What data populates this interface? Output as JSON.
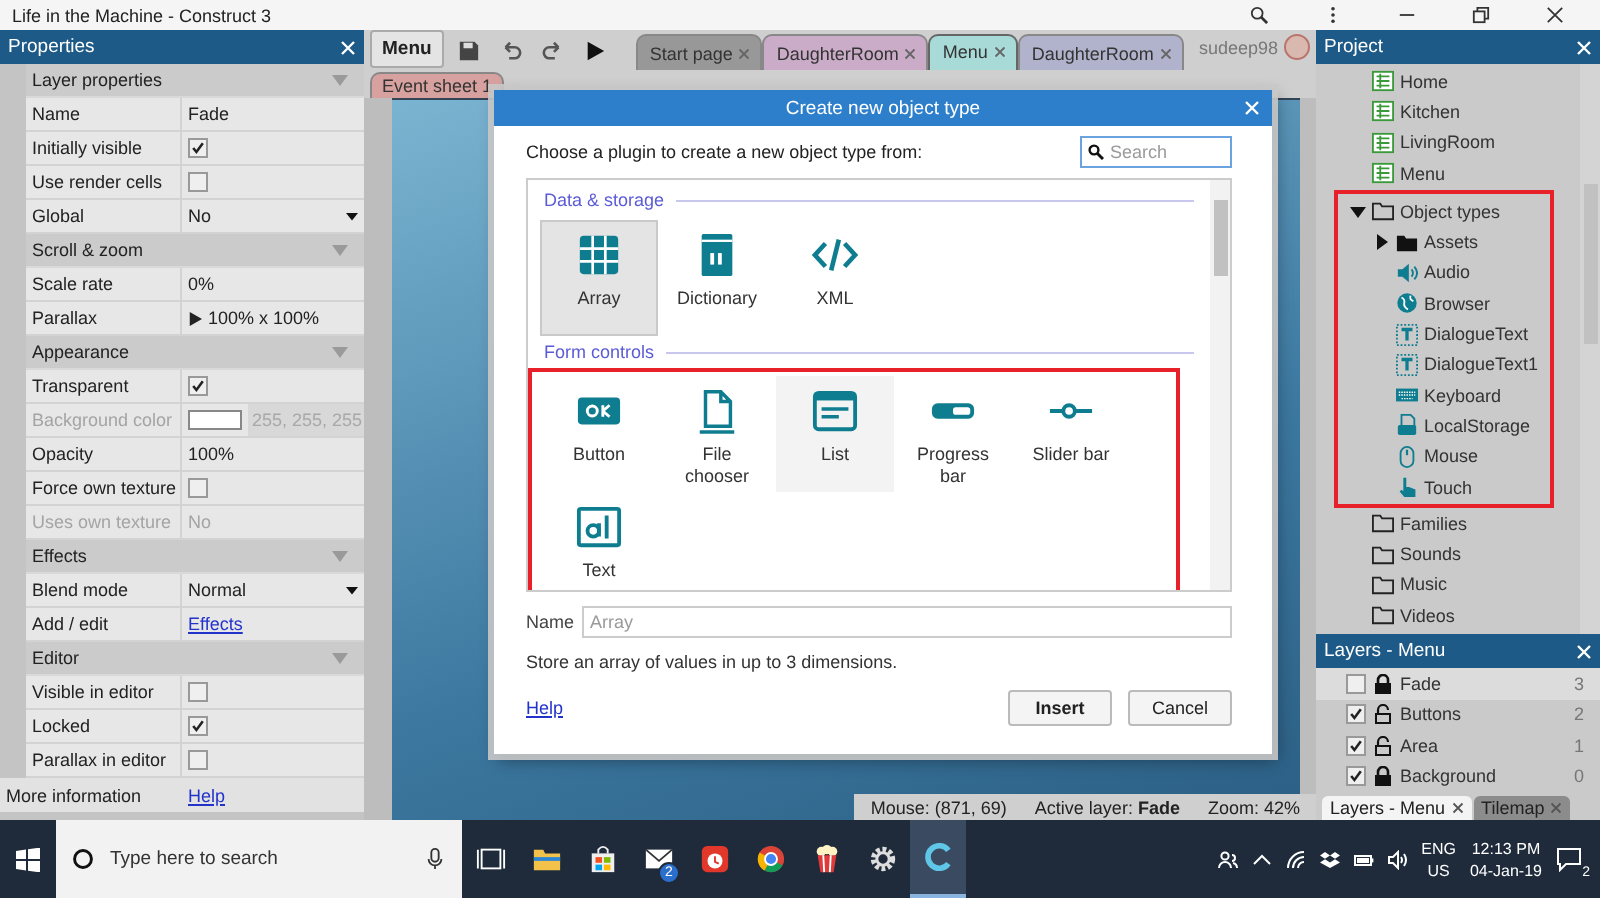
{
  "window": {
    "title": "Life in the Machine - Construct 3"
  },
  "properties": {
    "title": "Properties",
    "sections": [
      {
        "heading": "Layer properties",
        "rows": [
          {
            "kind": "text",
            "label": "Name",
            "value": "Fade",
            "disabled": false
          },
          {
            "kind": "check",
            "label": "Initially visible",
            "checked": true,
            "disabled": false
          },
          {
            "kind": "check",
            "label": "Use render cells",
            "checked": false,
            "disabled": false
          },
          {
            "kind": "dropdown",
            "label": "Global",
            "value": "No",
            "disabled": false
          }
        ]
      },
      {
        "heading": "Scroll & zoom",
        "rows": [
          {
            "kind": "text",
            "label": "Scale rate",
            "value": "0%",
            "disabled": false
          },
          {
            "kind": "expand",
            "label": "Parallax",
            "value": "100% x 100%",
            "disabled": false
          }
        ]
      },
      {
        "heading": "Appearance",
        "rows": [
          {
            "kind": "check",
            "label": "Transparent",
            "checked": true,
            "disabled": false
          },
          {
            "kind": "color",
            "label": "Background color",
            "value": "255, 255, 255",
            "disabled": true
          },
          {
            "kind": "text",
            "label": "Opacity",
            "value": "100%",
            "disabled": false
          },
          {
            "kind": "check",
            "label": "Force own texture",
            "checked": false,
            "disabled": false
          },
          {
            "kind": "text",
            "label": "Uses own texture",
            "value": "No",
            "disabled": true
          }
        ]
      },
      {
        "heading": "Effects",
        "rows": [
          {
            "kind": "dropdown",
            "label": "Blend mode",
            "value": "Normal",
            "disabled": false
          },
          {
            "kind": "link",
            "label": "Add / edit",
            "value": "Effects",
            "disabled": false
          }
        ]
      },
      {
        "heading": "Editor",
        "rows": [
          {
            "kind": "check",
            "label": "Visible in editor",
            "checked": false,
            "disabled": false
          },
          {
            "kind": "check",
            "label": "Locked",
            "checked": true,
            "disabled": false
          },
          {
            "kind": "check",
            "label": "Parallax in editor",
            "checked": false,
            "disabled": false
          }
        ]
      }
    ],
    "footer": {
      "label": "More information",
      "link": "Help"
    }
  },
  "toolbar": {
    "menu": "Menu",
    "user": "sudeep98",
    "tabs": [
      {
        "label": "Start page",
        "color": "#8a8a8a",
        "selected": false
      },
      {
        "label": "DaughterRoom",
        "color": "#c9a3c5",
        "selected": false
      },
      {
        "label": "Menu",
        "color": "#a8dbd7",
        "selected": true
      },
      {
        "label": "DaughterRoom",
        "color": "#a7abc9",
        "selected": false
      }
    ],
    "subtabs": [
      {
        "label": "Event sheet 1",
        "color": "#d6a19f"
      }
    ]
  },
  "status": {
    "mouse": "Mouse: (871, 69)",
    "active_layer": "Active layer: **Fade**",
    "zoom": "Zoom: 42%"
  },
  "dialog": {
    "title": "Create new object type",
    "prompt": "Choose a plugin to create a new object type from:",
    "search_placeholder": "Search",
    "groups": [
      {
        "heading": "Data & storage",
        "highlighted": false,
        "items": [
          {
            "kind": "array",
            "label": "Array",
            "selected": true,
            "hovered": false
          },
          {
            "kind": "dictionary",
            "label": "Dictionary",
            "selected": false,
            "hovered": false
          },
          {
            "kind": "xml",
            "label": "XML",
            "selected": false,
            "hovered": false
          }
        ]
      },
      {
        "heading": "Form controls",
        "highlighted": true,
        "items": [
          {
            "kind": "button",
            "label": "Button",
            "selected": false,
            "hovered": false
          },
          {
            "kind": "file",
            "label": "File chooser",
            "selected": false,
            "hovered": false
          },
          {
            "kind": "list",
            "label": "List",
            "selected": false,
            "hovered": true
          },
          {
            "kind": "progress",
            "label": "Progress bar",
            "selected": false,
            "hovered": false
          },
          {
            "kind": "slider",
            "label": "Slider bar",
            "selected": false,
            "hovered": false
          },
          {
            "kind": "textbox",
            "label": "Text",
            "selected": false,
            "hovered": false
          }
        ]
      }
    ],
    "name_label": "Name",
    "name_placeholder": "Array",
    "description": "Store an array of values in up to 3 dimensions.",
    "help": "Help",
    "buttons": [
      "Insert",
      "Cancel"
    ]
  },
  "project": {
    "title": "Project",
    "tree": [
      {
        "kind": "layout",
        "label": "Home"
      },
      {
        "kind": "layout",
        "label": "Kitchen"
      },
      {
        "kind": "layout",
        "label": "LivingRoom"
      },
      {
        "kind": "layout",
        "label": "Menu"
      },
      {
        "kind": "folder",
        "label": "Object types",
        "expanded": true,
        "highlighted": true,
        "children": [
          {
            "kind": "folder",
            "label": "Assets",
            "expanded": false,
            "filled": true
          },
          {
            "kind": "audio",
            "label": "Audio"
          },
          {
            "kind": "browser",
            "label": "Browser"
          },
          {
            "kind": "text",
            "label": "DialogueText"
          },
          {
            "kind": "text",
            "label": "DialogueText1"
          },
          {
            "kind": "keyboard",
            "label": "Keyboard"
          },
          {
            "kind": "storage",
            "label": "LocalStorage"
          },
          {
            "kind": "mouse",
            "label": "Mouse"
          },
          {
            "kind": "touch",
            "label": "Touch"
          }
        ]
      },
      {
        "kind": "folder",
        "label": "Families"
      },
      {
        "kind": "folder",
        "label": "Sounds"
      },
      {
        "kind": "folder",
        "label": "Music"
      },
      {
        "kind": "folder",
        "label": "Videos"
      }
    ]
  },
  "layers": {
    "title": "Layers - Menu",
    "rows": [
      {
        "name": "Fade",
        "visible": false,
        "locked": true,
        "index": "3",
        "selected": true
      },
      {
        "name": "Buttons",
        "visible": true,
        "locked": false,
        "index": "2",
        "selected": false
      },
      {
        "name": "Area",
        "visible": true,
        "locked": false,
        "index": "1",
        "selected": false
      },
      {
        "name": "Background",
        "visible": true,
        "locked": true,
        "index": "0",
        "selected": false
      }
    ],
    "tabs": [
      {
        "label": "Layers - Menu",
        "selected": true
      },
      {
        "label": "Tilemap",
        "selected": false
      }
    ]
  },
  "taskbar": {
    "search_placeholder": "Type here to search",
    "apps": [
      {
        "kind": "taskview",
        "selected": false
      },
      {
        "kind": "explorer",
        "selected": false
      },
      {
        "kind": "store",
        "selected": false
      },
      {
        "kind": "mail",
        "selected": false,
        "badge": "2"
      },
      {
        "kind": "red",
        "selected": false
      },
      {
        "kind": "chrome",
        "selected": false
      },
      {
        "kind": "popcorn",
        "selected": false
      },
      {
        "kind": "settings",
        "selected": false
      },
      {
        "kind": "construct",
        "selected": true
      }
    ],
    "language": "ENG",
    "region": "US",
    "time": "12:13 PM",
    "date": "04-Jan-19",
    "notifications": "2"
  }
}
